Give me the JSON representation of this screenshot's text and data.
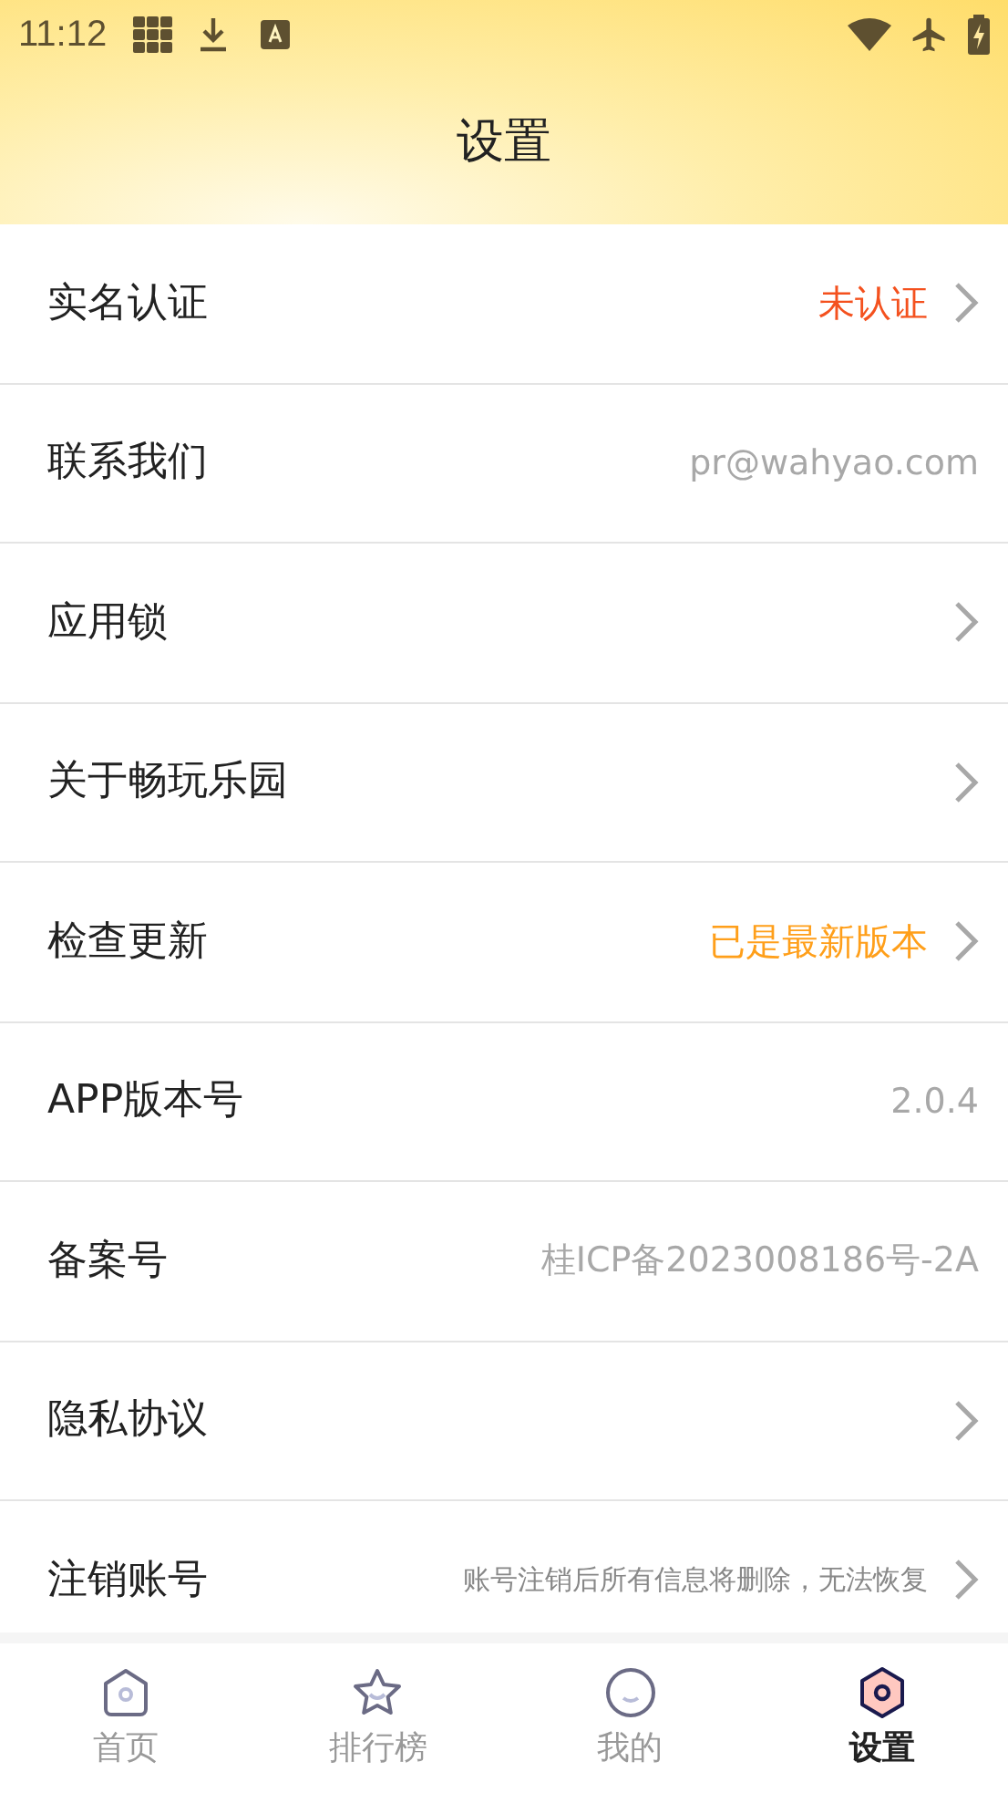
{
  "status_bar": {
    "time": "11:12"
  },
  "header": {
    "title": "设置"
  },
  "rows": [
    {
      "label": "实名认证",
      "value": "未认证",
      "kind": "alert",
      "chevron": true
    },
    {
      "label": "联系我们",
      "value": "pr@wahyao.com",
      "kind": "plain",
      "chevron": false
    },
    {
      "label": "应用锁",
      "chevron": true
    },
    {
      "label": "关于畅玩乐园",
      "chevron": true
    },
    {
      "label": "检查更新",
      "value": "已是最新版本",
      "kind": "notice",
      "chevron": true
    },
    {
      "label": "APP版本号",
      "value": "2.0.4",
      "kind": "plain",
      "chevron": false
    },
    {
      "label": "备案号",
      "value": "桂ICP备2023008186号-2A",
      "kind": "plain",
      "chevron": false
    },
    {
      "label": "隐私协议",
      "chevron": true
    },
    {
      "label": "注销账号",
      "value": "账号注销后所有信息将删除，无法恢复",
      "kind": "small",
      "chevron": true
    }
  ],
  "tabs": [
    {
      "label": "首页",
      "kind": "home",
      "selected": false
    },
    {
      "label": "排行榜",
      "kind": "star",
      "selected": false
    },
    {
      "label": "我的",
      "kind": "smile",
      "selected": false
    },
    {
      "label": "设置",
      "kind": "hex",
      "selected": true
    }
  ]
}
